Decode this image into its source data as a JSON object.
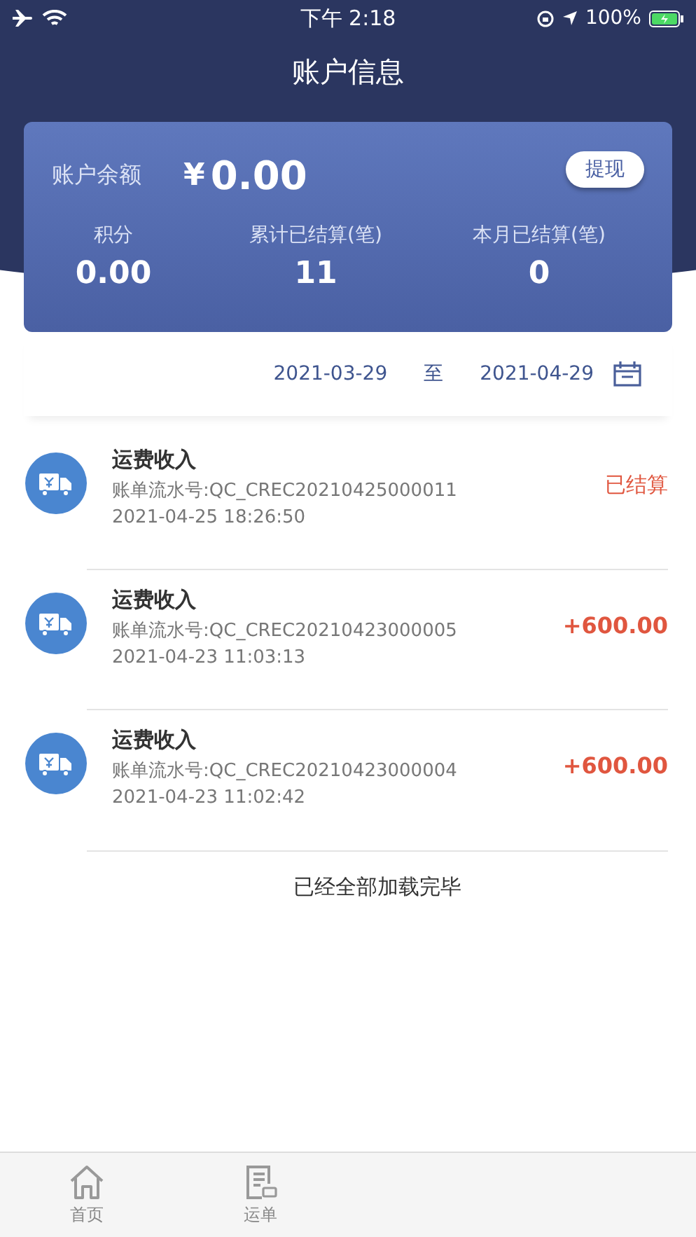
{
  "status_bar": {
    "time": "下午 2:18",
    "battery": "100%"
  },
  "title": "账户信息",
  "balance": {
    "label": "账户余额",
    "currency": "¥",
    "amount": "0.00",
    "withdraw_button": "提现"
  },
  "stats": [
    {
      "label": "积分",
      "value": "0.00"
    },
    {
      "label": "累计已结算(笔)",
      "value": "11"
    },
    {
      "label": "本月已结算(笔)",
      "value": "0"
    }
  ],
  "date_range": {
    "start": "2021-03-29",
    "separator": "至",
    "end": "2021-04-29"
  },
  "transactions": [
    {
      "title": "运费收入",
      "serial": "账单流水号:QC_CREC20210425000011",
      "time": "2021-04-25 18:26:50",
      "kind": "status",
      "result": "已结算"
    },
    {
      "title": "运费收入",
      "serial": "账单流水号:QC_CREC20210423000005",
      "time": "2021-04-23 11:03:13",
      "kind": "amount",
      "result": "+600.00"
    },
    {
      "title": "运费收入",
      "serial": "账单流水号:QC_CREC20210423000004",
      "time": "2021-04-23 11:02:42",
      "kind": "amount",
      "result": "+600.00"
    }
  ],
  "end_message": "已经全部加载完毕",
  "tabs": [
    {
      "label": "首页",
      "kind": "home"
    },
    {
      "label": "运单",
      "kind": "orders"
    }
  ]
}
